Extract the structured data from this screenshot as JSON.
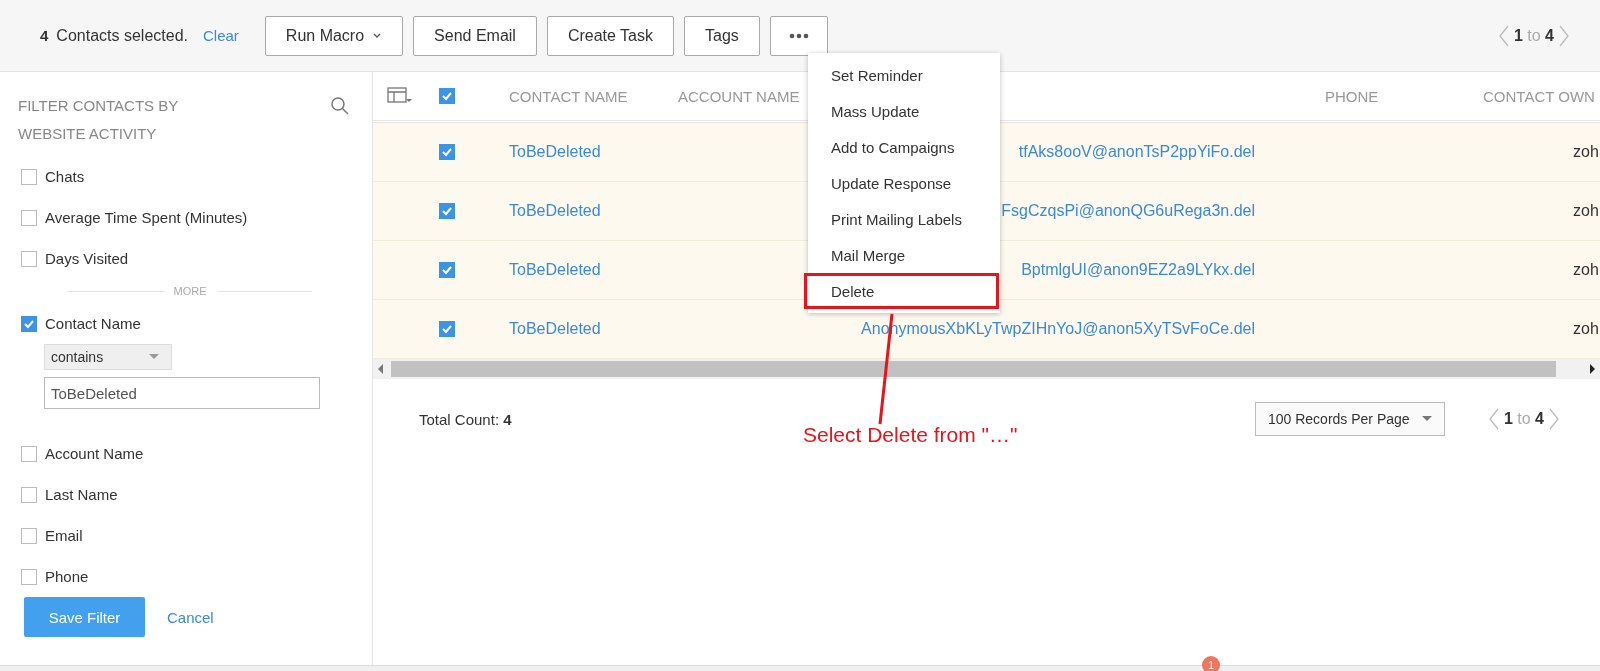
{
  "selection_bar": {
    "count": "4",
    "text": "Contacts selected.",
    "clear": "Clear",
    "pagination": "**1** to **4**",
    "buttons": [
      {
        "label": "Run Macro",
        "kind": "dropdown"
      },
      {
        "label": "Send Email",
        "kind": "plain"
      },
      {
        "label": "Create Task",
        "kind": "plain"
      },
      {
        "label": "Tags",
        "kind": "plain"
      },
      {
        "kind": "more"
      }
    ]
  },
  "more_menu": {
    "items": [
      {
        "label": "Set Reminder",
        "highlighted": false
      },
      {
        "label": "Mass Update",
        "highlighted": false
      },
      {
        "label": "Add to Campaigns",
        "highlighted": false
      },
      {
        "label": "Update Response",
        "highlighted": false
      },
      {
        "label": "Print Mailing Labels",
        "highlighted": false
      },
      {
        "label": "Mail Merge",
        "highlighted": false
      },
      {
        "label": "Delete",
        "highlighted": true
      }
    ]
  },
  "sidebar": {
    "title": "FILTER CONTACTS BY",
    "section": "WEBSITE ACTIVITY",
    "divider": "MORE",
    "save": "Save Filter",
    "cancel": "Cancel",
    "filters": [
      {
        "label": "Chats",
        "checked": false
      },
      {
        "label": "Average Time Spent (Minutes)",
        "checked": false
      },
      {
        "label": "Days Visited",
        "checked": false
      },
      {
        "kind": "divider"
      },
      {
        "label": "Contact Name",
        "checked": true,
        "operator": "contains",
        "value": "ToBeDeleted"
      },
      {
        "label": "Account Name",
        "checked": false
      },
      {
        "label": "Last Name",
        "checked": false
      },
      {
        "label": "Email",
        "checked": false
      },
      {
        "label": "Phone",
        "checked": false
      }
    ]
  },
  "table": {
    "select_all_checked": true,
    "columns": [
      "CONTACT NAME",
      "ACCOUNT NAME",
      "PHONE",
      "CONTACT OWN"
    ],
    "rows": [
      {
        "checked": true,
        "contact_name": "ToBeDeleted",
        "email": "tfAks8ooV@anonTsP2ppYiFo.del",
        "contact_owner": "zoh"
      },
      {
        "checked": true,
        "contact_name": "ToBeDeleted",
        "email": "FsgCzqsPi@anonQG6uRega3n.del",
        "contact_owner": "zoh"
      },
      {
        "checked": true,
        "contact_name": "ToBeDeleted",
        "email": "BptmlgUI@anon9EZ2a9LYkx.del",
        "contact_owner": "zoh"
      },
      {
        "checked": true,
        "contact_name": "ToBeDeleted",
        "email": "AnonymousXbKLyTwpZIHnYoJ@anon5XyTSvFoCe.del",
        "contact_owner": "zoh"
      }
    ]
  },
  "footer": {
    "total_label": "Total Count:",
    "total": "4",
    "per_page": "100 Records Per Page",
    "pagination": "**1** to **4**"
  },
  "annotation": {
    "text": "Select Delete from \"…\""
  },
  "taskbar": {
    "badge": "1"
  }
}
